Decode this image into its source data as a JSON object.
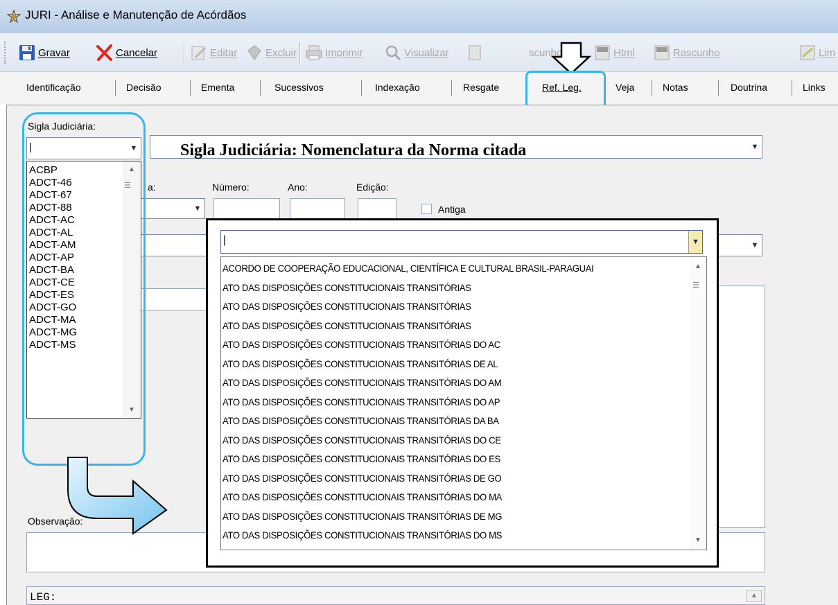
{
  "window": {
    "title": "JURI - Análise e Manutenção de Acórdãos"
  },
  "toolbar": {
    "gravar": "Gravar",
    "cancelar": "Cancelar",
    "editar": "Editar",
    "excluir": "Excluir",
    "imprimir": "Imprimir",
    "visualizar": "Visualizar",
    "rascunho_partial": "scunho",
    "html": "Html",
    "rascunho": "Rascunho",
    "limpar_partial": "Lim"
  },
  "tabs": [
    "Identificação",
    "Decisão",
    "Ementa",
    "Sucessivos",
    "Indexação",
    "Resgate",
    "Ref. Leg.",
    "Veja",
    "Notas",
    "Doutrina",
    "Links"
  ],
  "form": {
    "sigla_label": "Sigla Judiciária:",
    "sigla_value": "|",
    "tipo_label_partial": "a:",
    "numero_label": "Número:",
    "ano_label": "Ano:",
    "edicao_label": "Edição:",
    "antiga_label": "Antiga",
    "observacao_label": "Observação:",
    "leg_text": "LEG:"
  },
  "annotation": {
    "heading": "Sigla Judiciária: Nomenclatura da Norma citada"
  },
  "sigla_list": [
    "ACBP",
    "ADCT-46",
    "ADCT-67",
    "ADCT-88",
    "ADCT-AC",
    "ADCT-AL",
    "ADCT-AM",
    "ADCT-AP",
    "ADCT-BA",
    "ADCT-CE",
    "ADCT-ES",
    "ADCT-GO",
    "ADCT-MA",
    "ADCT-MG",
    "ADCT-MS"
  ],
  "nomenclatura_input": "|",
  "nomenclatura_list": [
    "ACORDO DE COOPERAÇÃO EDUCACIONAL, CIENTÍFICA E CULTURAL BRASIL-PARAGUAI",
    "ATO DAS DISPOSIÇÕES CONSTITUCIONAIS TRANSITÓRIAS",
    "ATO DAS DISPOSIÇÕES CONSTITUCIONAIS TRANSITÓRIAS",
    "ATO DAS DISPOSIÇÕES CONSTITUCIONAIS TRANSITÓRIAS",
    "ATO DAS DISPOSIÇÕES CONSTITUCIONAIS TRANSITÓRIAS DO AC",
    "ATO DAS DISPOSIÇÕES CONSTITUCIONAIS TRANSITÓRIAS DE AL",
    "ATO DAS DISPOSIÇÕES CONSTITUCIONAIS TRANSITÓRIAS DO AM",
    "ATO DAS DISPOSIÇÕES CONSTITUCIONAIS TRANSITÓRIAS DO AP",
    "ATO DAS DISPOSIÇÕES CONSTITUCIONAIS TRANSITÓRIAS DA BA",
    "ATO DAS DISPOSIÇÕES CONSTITUCIONAIS TRANSITÓRIAS DO CE",
    "ATO DAS DISPOSIÇÕES CONSTITUCIONAIS TRANSITÓRIAS DO ES",
    "ATO DAS DISPOSIÇÕES CONSTITUCIONAIS TRANSITÓRIAS DE GO",
    "ATO DAS DISPOSIÇÕES CONSTITUCIONAIS TRANSITÓRIAS DO MA",
    "ATO DAS DISPOSIÇÕES CONSTITUCIONAIS TRANSITÓRIAS DE MG",
    "ATO DAS DISPOSIÇÕES CONSTITUCIONAIS TRANSITÓRIAS DO MS"
  ],
  "colors": {
    "callout": "#39b5ea",
    "arrow_fill": "#9fd6f5"
  }
}
